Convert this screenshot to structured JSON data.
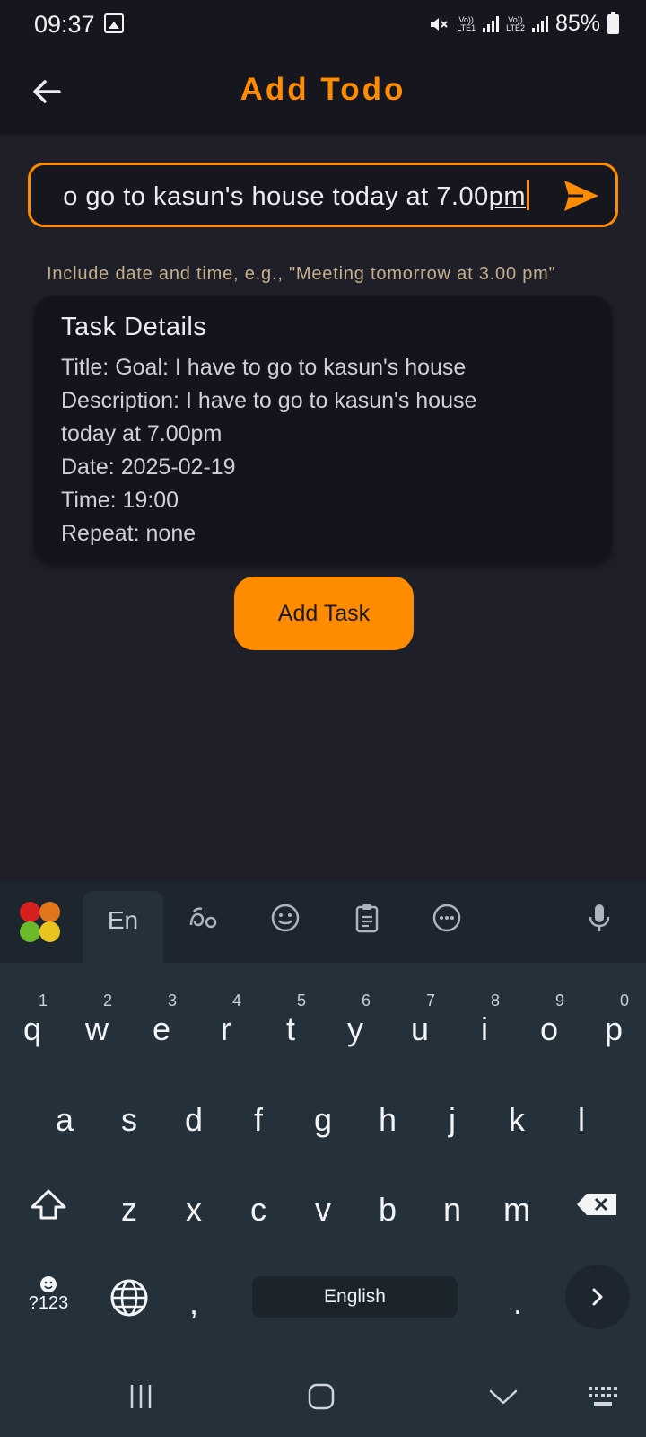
{
  "status_bar": {
    "time": "09:37",
    "battery_percent": "85%",
    "net1_top": "Vo))",
    "net1_bottom": "LTE1",
    "net2_top": "Vo))",
    "net2_bottom": "LTE2",
    "icons": [
      "gallery-icon",
      "mute-icon",
      "signal-icon",
      "battery-icon"
    ]
  },
  "app_bar": {
    "title": "Add Todo",
    "accent_color": "#ff8c00"
  },
  "input": {
    "value_prefix": "o go to kasun's house today at 7.00",
    "value_underlined": "pm",
    "hint": "Include date and time, e.g., \"Meeting tomorrow at 3.00 pm\""
  },
  "task_details": {
    "heading": "Task Details",
    "title_line": "Title: Goal: I have to go to kasun's house",
    "description_line1": "Description: I have to go to kasun's house",
    "description_line2": "today at 7.00pm",
    "date_line": "Date: 2025-02-19",
    "time_line": "Time: 19:00",
    "repeat_line": "Repeat: none"
  },
  "add_button": {
    "label": "Add Task"
  },
  "keyboard": {
    "tab_label": "En",
    "row1": [
      "q",
      "w",
      "e",
      "r",
      "t",
      "y",
      "u",
      "i",
      "o",
      "p"
    ],
    "row1_numbers": [
      "1",
      "2",
      "3",
      "4",
      "5",
      "6",
      "7",
      "8",
      "9",
      "0"
    ],
    "row2": [
      "a",
      "s",
      "d",
      "f",
      "g",
      "h",
      "j",
      "k",
      "l"
    ],
    "row3": [
      "z",
      "x",
      "c",
      "v",
      "b",
      "n",
      "m"
    ],
    "symbols_label": "?123",
    "comma": ",",
    "space_label": "English",
    "period": "."
  }
}
